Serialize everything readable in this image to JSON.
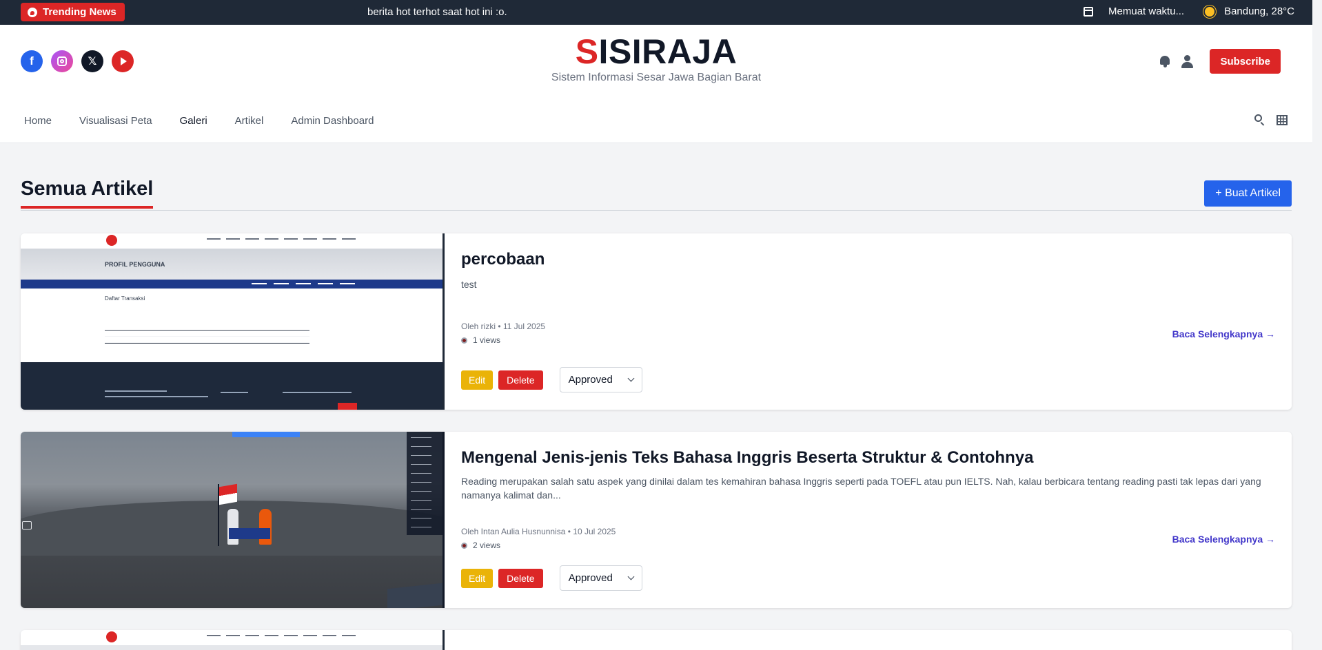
{
  "topbar": {
    "trending_label": "Trending News",
    "ticker_text": "berita hot terhot saat hot ini :o.",
    "time_text": "Memuat waktu...",
    "weather_text": "Bandung, 28°C"
  },
  "header": {
    "logo_first_letter": "S",
    "logo_rest": "ISIRAJA",
    "tagline": "Sistem Informasi Sesar Jawa Bagian Barat",
    "subscribe_label": "Subscribe",
    "socials": [
      "facebook-icon",
      "instagram-icon",
      "x-icon",
      "youtube-icon"
    ]
  },
  "nav": {
    "items": [
      "Home",
      "Visualisasi Peta",
      "Galeri",
      "Artikel",
      "Admin Dashboard"
    ],
    "active": "Galeri"
  },
  "page": {
    "title": "Semua Artikel",
    "create_label": "+ Buat Artikel"
  },
  "articles": [
    {
      "title": "percobaan",
      "excerpt": "test",
      "meta": "Oleh rizki • 11 Jul 2025",
      "views": "1 views",
      "read_more": "Baca Selengkapnya →",
      "edit_label": "Edit",
      "delete_label": "Delete",
      "status": "Approved",
      "thumb": {
        "banner": "PROFIL PENGGUNA",
        "heading": "Daftar Transaksi"
      }
    },
    {
      "title": "Mengenal Jenis-jenis Teks Bahasa Inggris Beserta Struktur & Contohnya",
      "excerpt": "Reading merupakan salah satu aspek yang dinilai dalam tes kemahiran bahasa Inggris seperti pada TOEFL atau pun IELTS. Nah, kalau berbicara tentang reading pasti tak lepas dari yang namanya kalimat dan...",
      "meta": "Oleh Intan Aulia Husnunnisa • 10 Jul 2025",
      "views": "2 views",
      "read_more": "Baca Selengkapnya →",
      "edit_label": "Edit",
      "delete_label": "Delete",
      "status": "Approved"
    }
  ],
  "colors": {
    "brand_red": "#dc2626",
    "primary_blue": "#2563eb",
    "edit_yellow": "#eab308",
    "topbar_dark": "#1f2937",
    "link_indigo": "#4338ca"
  }
}
